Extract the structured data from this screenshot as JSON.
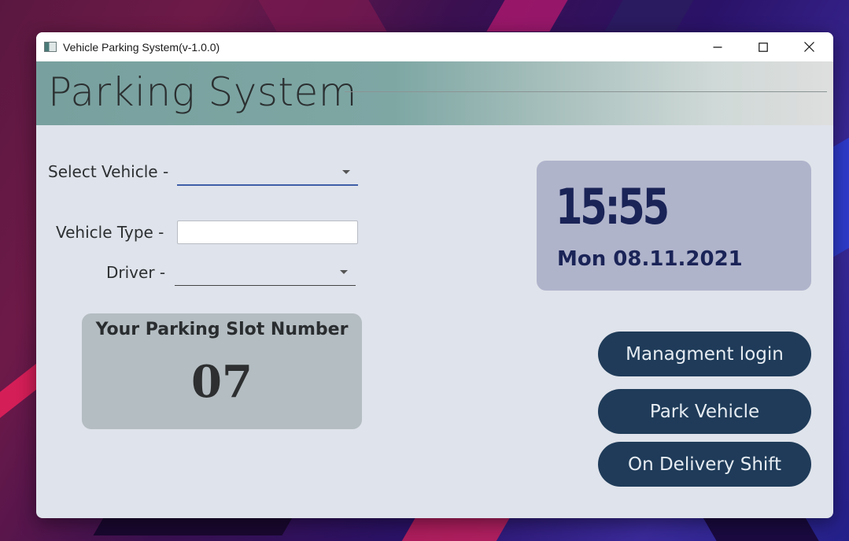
{
  "window": {
    "title": "Vehicle Parking System(v-1.0.0)",
    "controls": {
      "minimize_icon": "minimize-icon",
      "maximize_icon": "maximize-icon",
      "close_icon": "close-icon"
    }
  },
  "header": {
    "title": "Parking System"
  },
  "form": {
    "select_vehicle": {
      "label": "Select Vehicle -",
      "value": ""
    },
    "vehicle_type": {
      "label": "Vehicle Type -",
      "value": ""
    },
    "driver": {
      "label": "Driver -",
      "value": ""
    }
  },
  "slot": {
    "title": "Your Parking Slot Number",
    "number": "07"
  },
  "clock": {
    "time": "15:55",
    "date": "Mon 08.11.2021"
  },
  "buttons": {
    "management_login": "Managment login",
    "park_vehicle": "Park Vehicle",
    "on_delivery_shift": "On Delivery Shift"
  },
  "colors": {
    "button_bg": "#1f3b59",
    "clock_text": "#1b2457",
    "clock_panel": "#b0b4cb",
    "slot_panel": "#b4bdc2",
    "header_gradient_start": "#78a09e",
    "window_bg": "#dfe3eb"
  }
}
